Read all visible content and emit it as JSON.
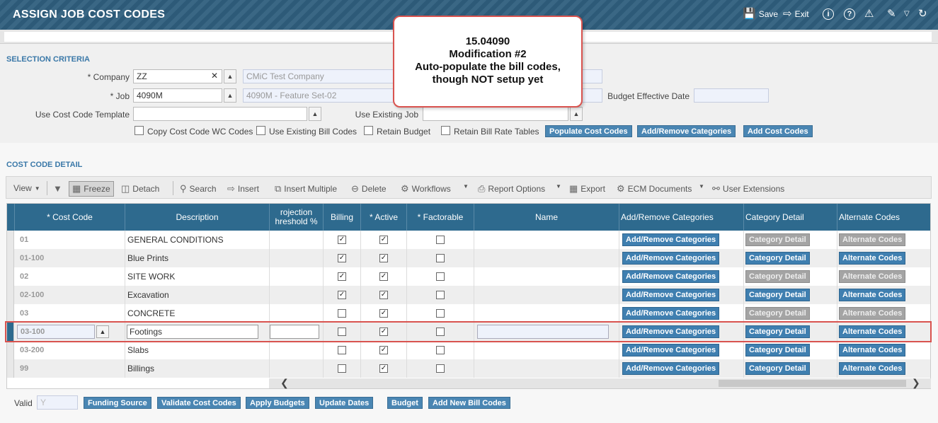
{
  "header": {
    "title": "ASSIGN JOB COST CODES",
    "save_label": "Save",
    "exit_label": "Exit",
    "icons": [
      "save-icon",
      "exit-icon",
      "info-icon",
      "help-icon",
      "warning-icon",
      "edit-icon",
      "dropdown-icon",
      "refresh-icon"
    ]
  },
  "callout": {
    "line1": "15.04090",
    "line2": "Modification #2",
    "line3": "Auto-populate the bill codes,",
    "line4": "though NOT setup yet"
  },
  "selection": {
    "title": "SELECTION CRITERIA",
    "company_label": "* Company",
    "company_value": "ZZ",
    "company_name": "CMiC Test Company",
    "job_label": "* Job",
    "job_value": "4090M",
    "job_name": "4090M - Feature Set-02",
    "budget_date_label": "Budget Effective Date",
    "template_label": "Use Cost Code Template",
    "existing_job_label": "Use Existing Job",
    "options": {
      "copy_wc": "Copy Cost Code WC Codes",
      "existing_bill": "Use Existing Bill Codes",
      "retain_budget": "Retain Budget",
      "retain_bill_rate": "Retain Bill Rate Tables"
    },
    "buttons": {
      "populate": "Populate Cost Codes",
      "add_remove": "Add/Remove Categories",
      "add_cost": "Add Cost Codes"
    }
  },
  "detail": {
    "title": "COST CODE DETAIL",
    "toolbar": {
      "view": "View",
      "freeze": "Freeze",
      "detach": "Detach",
      "search": "Search",
      "insert": "Insert",
      "insert_multiple": "Insert Multiple",
      "delete": "Delete",
      "workflows": "Workflows",
      "report_options": "Report Options",
      "export": "Export",
      "ecm": "ECM Documents",
      "user_ext": "User Extensions"
    },
    "columns": {
      "cost_code": "* Cost Code",
      "description": "Description",
      "projection_1": "rojection",
      "projection_2": "hreshold %",
      "billing": "Billing",
      "active": "* Active",
      "factorable": "* Factorable",
      "name": "Name",
      "add_remove": "Add/Remove Categories",
      "category_detail": "Category Detail",
      "alternate": "Alternate Codes"
    },
    "buttons": {
      "add_remove": "Add/Remove Categories",
      "category_detail": "Category Detail",
      "alternate": "Alternate Codes"
    },
    "rows": [
      {
        "code": "01",
        "desc": "GENERAL CONDITIONS"
      },
      {
        "code": "01-100",
        "desc": "Blue Prints"
      },
      {
        "code": "02",
        "desc": "SITE WORK"
      },
      {
        "code": "02-100",
        "desc": "Excavation"
      },
      {
        "code": "03",
        "desc": "CONCRETE"
      },
      {
        "code": "03-100",
        "desc": "Footings"
      },
      {
        "code": "03-200",
        "desc": "Slabs"
      },
      {
        "code": "99",
        "desc": "Billings"
      }
    ]
  },
  "footer": {
    "valid_label": "Valid",
    "valid_value": "Y",
    "funding": "Funding Source",
    "validate": "Validate Cost Codes",
    "apply": "Apply Budgets",
    "update": "Update Dates",
    "budget": "Budget",
    "add_bill": "Add New Bill Codes"
  },
  "colors": {
    "header_bg": "#2f5f7e",
    "grid_header": "#2e6a8e",
    "button": "#4a86b3",
    "highlight": "#d9534f"
  }
}
